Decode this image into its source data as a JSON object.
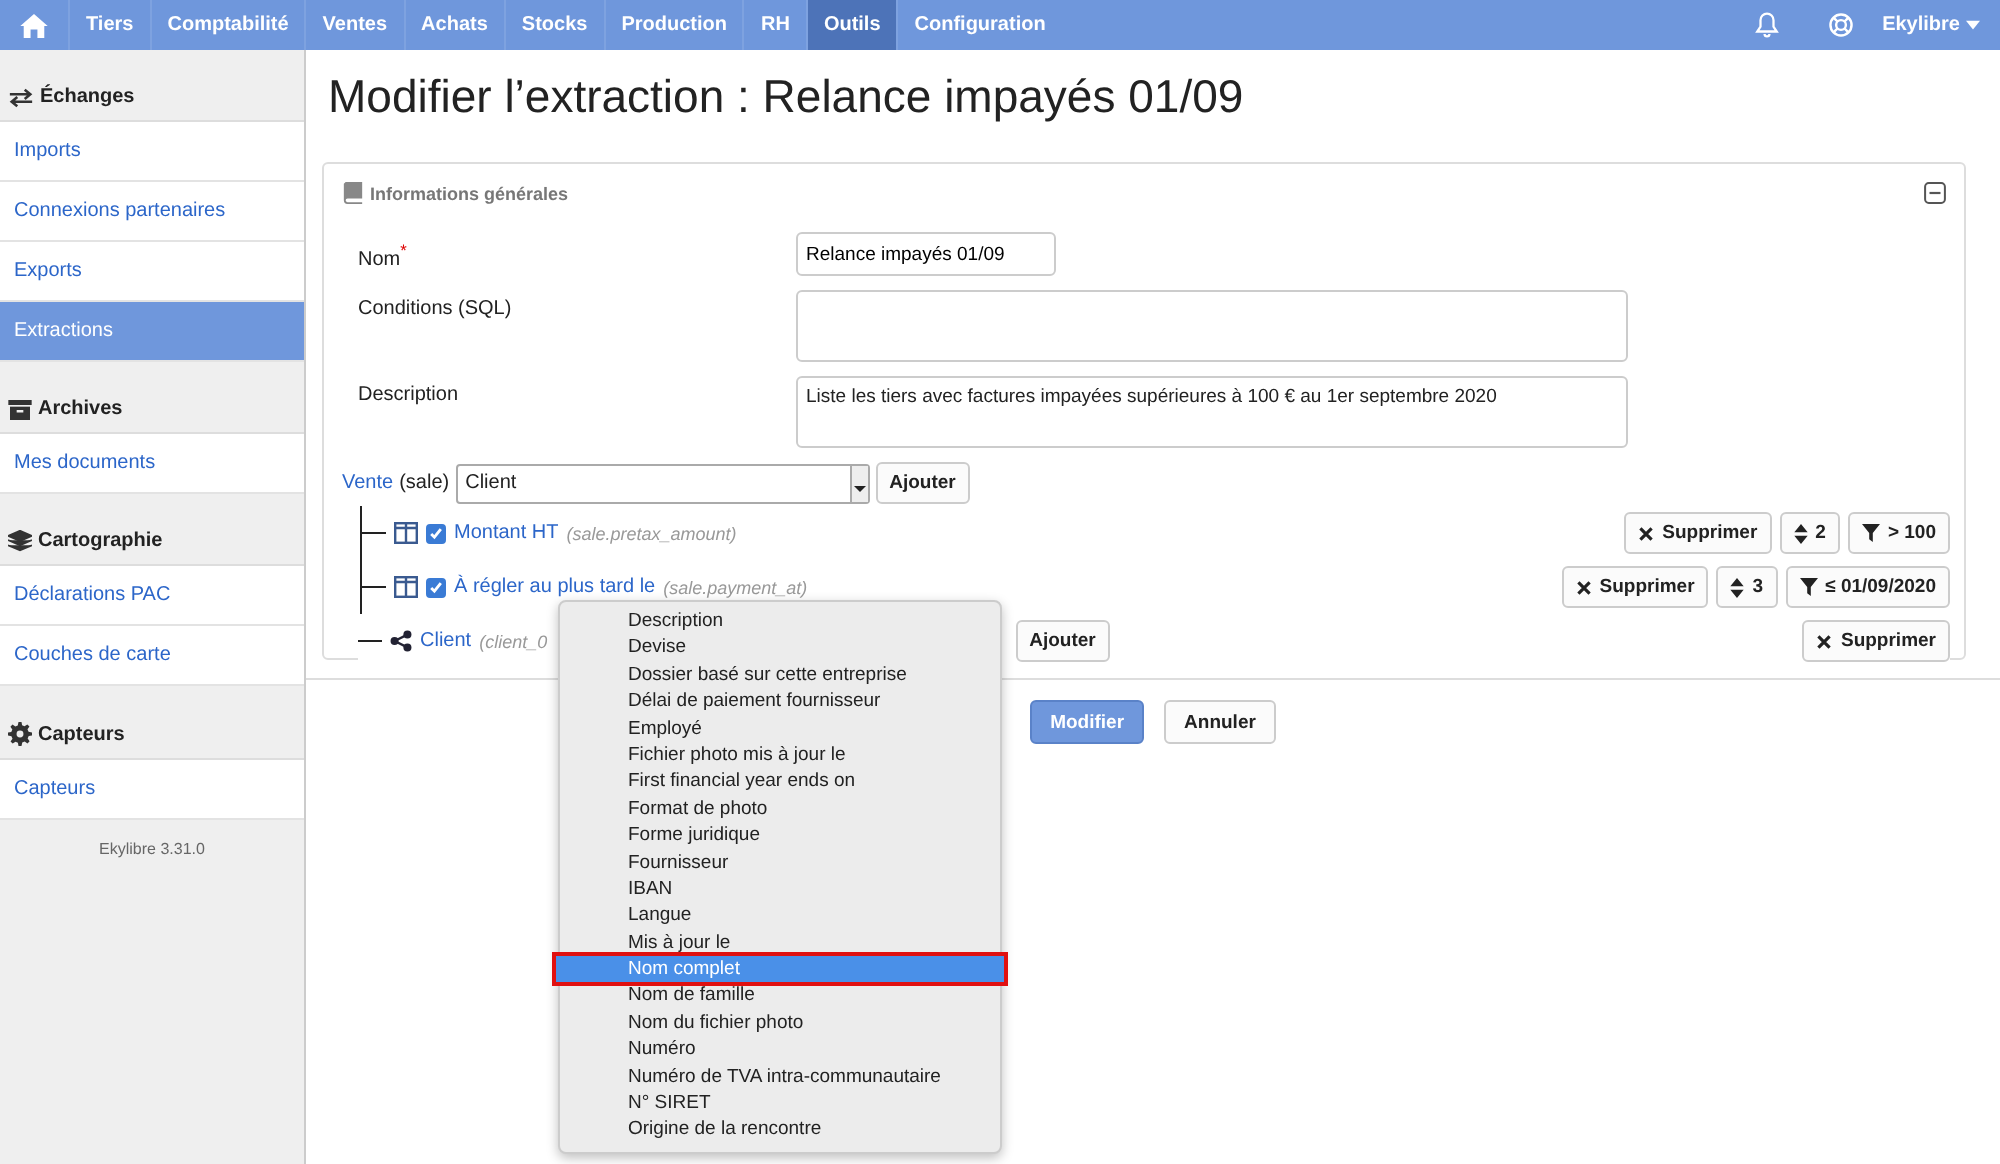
{
  "nav": {
    "items": [
      {
        "label": "Tiers",
        "selected": false
      },
      {
        "label": "Comptabilité",
        "selected": false
      },
      {
        "label": "Ventes",
        "selected": false
      },
      {
        "label": "Achats",
        "selected": false
      },
      {
        "label": "Stocks",
        "selected": false
      },
      {
        "label": "Production",
        "selected": false
      },
      {
        "label": "RH",
        "selected": false
      },
      {
        "label": "Outils",
        "selected": true
      },
      {
        "label": "Configuration",
        "selected": false
      }
    ],
    "user": "Ekylibre"
  },
  "sidebar": {
    "sections": [
      {
        "kind": "exchange",
        "title": "Échanges",
        "items": [
          {
            "label": "Imports",
            "selected": false
          },
          {
            "label": "Connexions partenaires",
            "selected": false
          },
          {
            "label": "Exports",
            "selected": false
          },
          {
            "label": "Extractions",
            "selected": true
          }
        ]
      },
      {
        "kind": "archive",
        "title": "Archives",
        "items": [
          {
            "label": "Mes documents",
            "selected": false
          }
        ]
      },
      {
        "kind": "layers",
        "title": "Cartographie",
        "items": [
          {
            "label": "Déclarations PAC",
            "selected": false
          },
          {
            "label": "Couches de carte",
            "selected": false
          }
        ]
      },
      {
        "kind": "gear",
        "title": "Capteurs",
        "items": [
          {
            "label": "Capteurs",
            "selected": false
          }
        ]
      }
    ],
    "version": "Ekylibre 3.31.0"
  },
  "page_title": "Modifier l’extraction : Relance impayés 01/09",
  "panel": {
    "title": "Informations générales",
    "expanded": true,
    "fields": [
      {
        "label": "Nom",
        "marker": "*",
        "value": "Relance impayés 01/09",
        "kind": "short"
      },
      {
        "label": "Conditions (SQL)",
        "kind": "area"
      },
      {
        "label": "Description",
        "value": "Liste les tiers avec factures impayées supérieures à 100 € au 1er septembre 2020",
        "kind": "area"
      }
    ],
    "root": {
      "link": "Vente",
      "code": "(sale)",
      "select": "Client",
      "button": "Ajouter"
    },
    "rows": [
      {
        "kind": "column",
        "checked": true,
        "label": "Montant HT",
        "path": "(sale.pretax_amount)",
        "actions": [
          {
            "kind": "delete",
            "label": "Supprimer"
          },
          {
            "kind": "sort",
            "label": "2"
          },
          {
            "kind": "filter",
            "label": "> 100"
          }
        ]
      },
      {
        "kind": "column",
        "checked": true,
        "label": "À régler au plus tard le",
        "path": "(sale.payment_at)",
        "actions": [
          {
            "kind": "delete",
            "label": "Supprimer"
          },
          {
            "kind": "sort",
            "label": "3"
          },
          {
            "kind": "filter",
            "label": "≤ 01/09/2020"
          }
        ]
      },
      {
        "kind": "relation",
        "label": "Client",
        "path": "(client_0",
        "button": "Ajouter",
        "actions": [
          {
            "kind": "delete",
            "label": "Supprimer"
          }
        ]
      }
    ]
  },
  "buttons": [
    {
      "label": "Modifier",
      "primary": true
    },
    {
      "label": "Annuler",
      "primary": false
    }
  ],
  "dropdown": {
    "options": [
      {
        "label": "Description",
        "selected": false
      },
      {
        "label": "Devise",
        "selected": false
      },
      {
        "label": "Dossier basé sur cette entreprise",
        "selected": false
      },
      {
        "label": "Délai de paiement fournisseur",
        "selected": false
      },
      {
        "label": "Employé",
        "selected": false
      },
      {
        "label": "Fichier photo mis à jour le",
        "selected": false
      },
      {
        "label": "First financial year ends on",
        "selected": false
      },
      {
        "label": "Format de photo",
        "selected": false
      },
      {
        "label": "Forme juridique",
        "selected": false
      },
      {
        "label": "Fournisseur",
        "selected": false
      },
      {
        "label": "IBAN",
        "selected": false
      },
      {
        "label": "Langue",
        "selected": false
      },
      {
        "label": "Mis à jour le",
        "selected": false
      },
      {
        "label": "Nom complet",
        "selected": true
      },
      {
        "label": "Nom de famille",
        "selected": false
      },
      {
        "label": "Nom du fichier photo",
        "selected": false
      },
      {
        "label": "Numéro",
        "selected": false
      },
      {
        "label": "Numéro de TVA intra-communautaire",
        "selected": false
      },
      {
        "label": "N° SIRET",
        "selected": false
      },
      {
        "label": "Origine de la rencontre",
        "selected": false
      }
    ]
  }
}
